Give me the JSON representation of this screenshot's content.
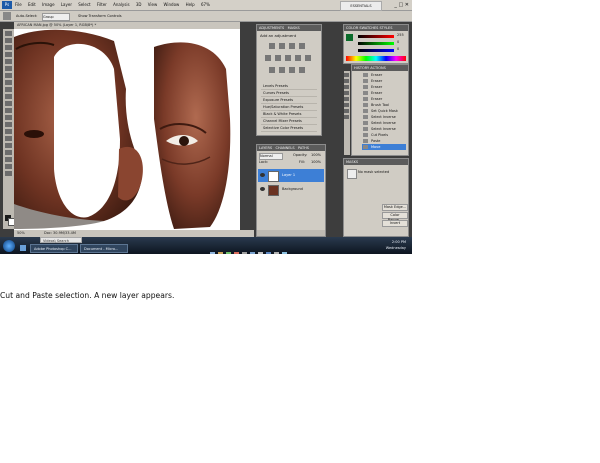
{
  "window": {
    "app_icon": "Ps",
    "workspace": "ESSENTIALS",
    "window_buttons": "_ □ ✕",
    "zoom": "67%"
  },
  "menus": [
    "File",
    "Edit",
    "Image",
    "Layer",
    "Select",
    "Filter",
    "Analysis",
    "3D",
    "View",
    "Window",
    "Help"
  ],
  "options_bar": {
    "auto_select": "Auto-Select:",
    "auto_select_value": "Group",
    "show_transform": "Show Transform Controls"
  },
  "document": {
    "tab_title": "AFRICAN MAN.jpg @ 50% (Layer 1, RGB/8*) *",
    "zoom": "50%",
    "doc_size": "Doc: 30.9M/33.4M"
  },
  "adjustments": {
    "tab": "ADJUSTMENTS",
    "masks_tab": "MASKS",
    "heading": "Add an adjustment",
    "presets": [
      "Levels Presets",
      "Curves Presets",
      "Exposure Presets",
      "Hue/Saturation Presets",
      "Black & White Presets",
      "Channel Mixer Presets",
      "Selective Color Presets"
    ]
  },
  "layers": {
    "tab": "LAYERS",
    "channels_tab": "CHANNELS",
    "paths_tab": "PATHS",
    "blend_mode": "Normal",
    "opacity_label": "Opacity:",
    "opacity": "100%",
    "lock_label": "Lock:",
    "fill_label": "Fill:",
    "fill": "100%",
    "items": [
      {
        "name": "Layer 1",
        "selected": true
      },
      {
        "name": "Background",
        "selected": false
      }
    ]
  },
  "color_panel": {
    "tab": "COLOR",
    "swatches_tab": "SWATCHES",
    "styles_tab": "STYLES",
    "r": "255",
    "g": "0",
    "b": "0"
  },
  "history": {
    "tab": "HISTORY",
    "actions_tab": "ACTIONS",
    "items": [
      "Eraser",
      "Eraser",
      "Eraser",
      "Eraser",
      "Eraser",
      "Brush Tool",
      "Set Quick Mask",
      "Select Inverse",
      "Select Inverse",
      "Select Inverse",
      "Cut Pixels",
      "Paste",
      "Move"
    ]
  },
  "masks": {
    "tab": "MASKS",
    "no_mask": "No mask selected",
    "buttons": [
      "Mask Edge...",
      "Color Range...",
      "Invert"
    ]
  },
  "taskbar": {
    "search_placeholder": "Videos\\ Search",
    "items": [
      "Adobe Photoshop C...",
      "Document - Micro..."
    ],
    "time": "2:00 PM",
    "day": "Wednesday"
  },
  "caption": "Cut and Paste selection. A new layer appears."
}
